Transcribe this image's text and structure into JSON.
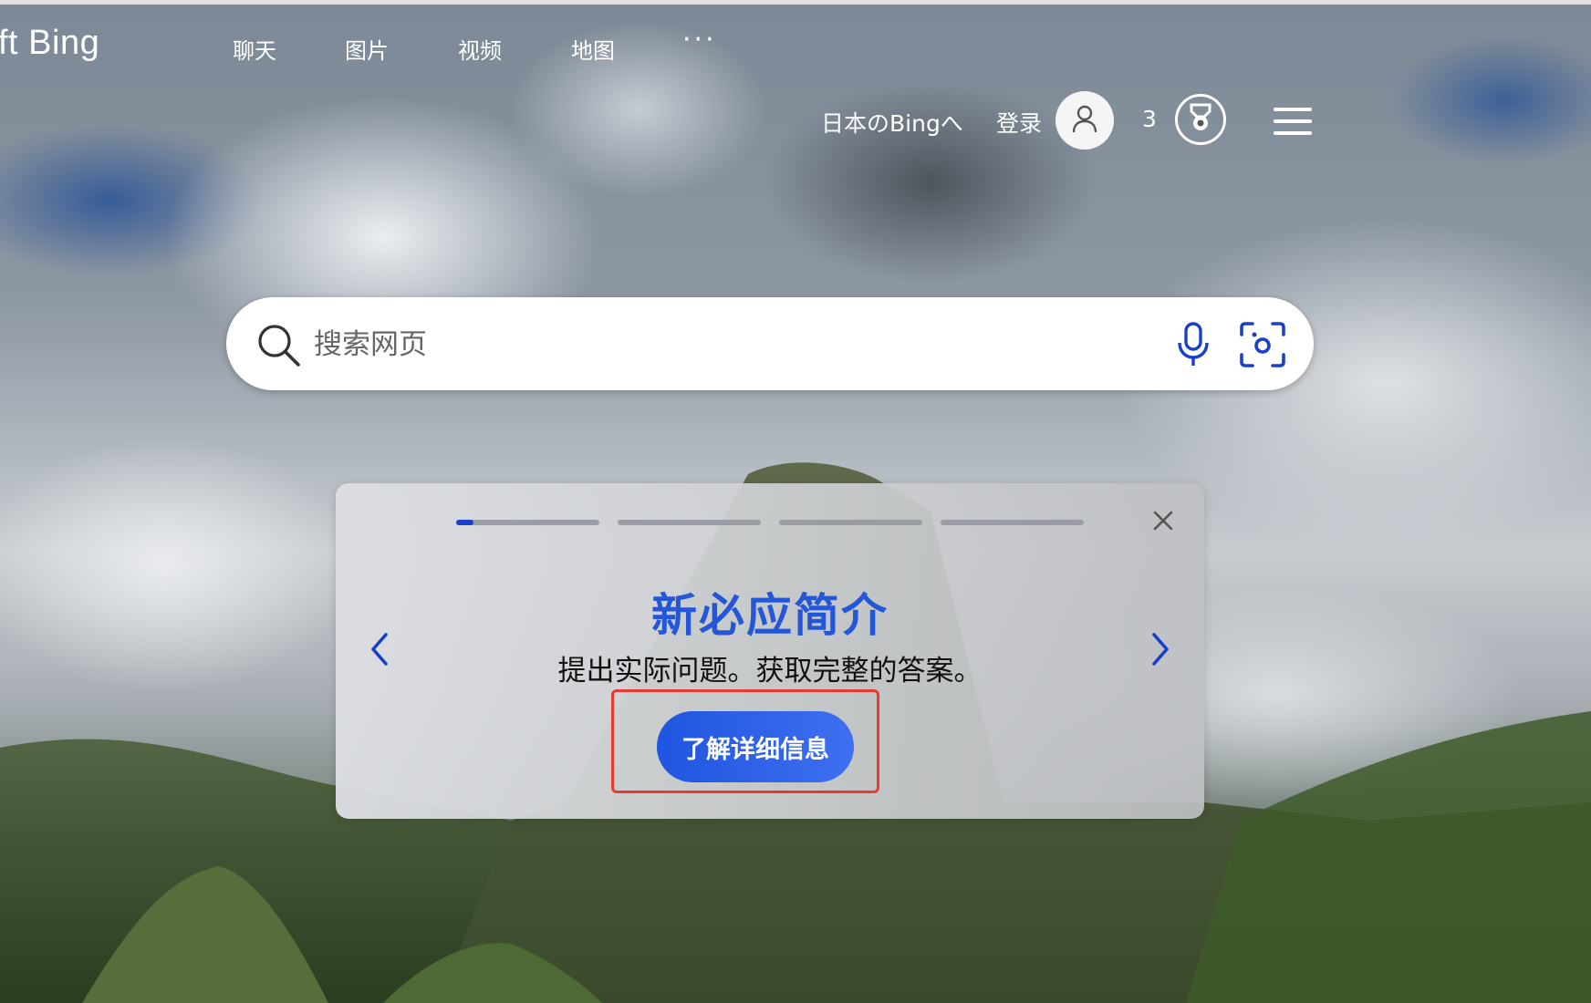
{
  "header": {
    "brand": "ft Bing",
    "nav": [
      {
        "label": "聊天"
      },
      {
        "label": "图片"
      },
      {
        "label": "视频"
      },
      {
        "label": "地图"
      }
    ],
    "more_label": "···",
    "region_link": "日本のBingへ",
    "login_label": "登录",
    "reward_points": "3"
  },
  "search": {
    "placeholder": "搜索网页"
  },
  "intro_card": {
    "title": "新必应简介",
    "subtitle": "提出实际问题。获取完整的答案。",
    "cta_label": "了解详细信息",
    "progress_steps": 4,
    "active_step": 1,
    "active_step_fraction": 0.12
  },
  "colors": {
    "accent_blue": "#2456d8",
    "cta_blue": "#1f55e0",
    "highlight_red": "#e63b2e"
  },
  "icons": {
    "search": "search-icon",
    "mic": "microphone-icon",
    "visual_search": "camera-search-icon",
    "avatar": "user-icon",
    "rewards": "medal-icon",
    "menu": "hamburger-menu-icon",
    "close": "close-icon",
    "prev": "chevron-left-icon",
    "next": "chevron-right-icon"
  }
}
